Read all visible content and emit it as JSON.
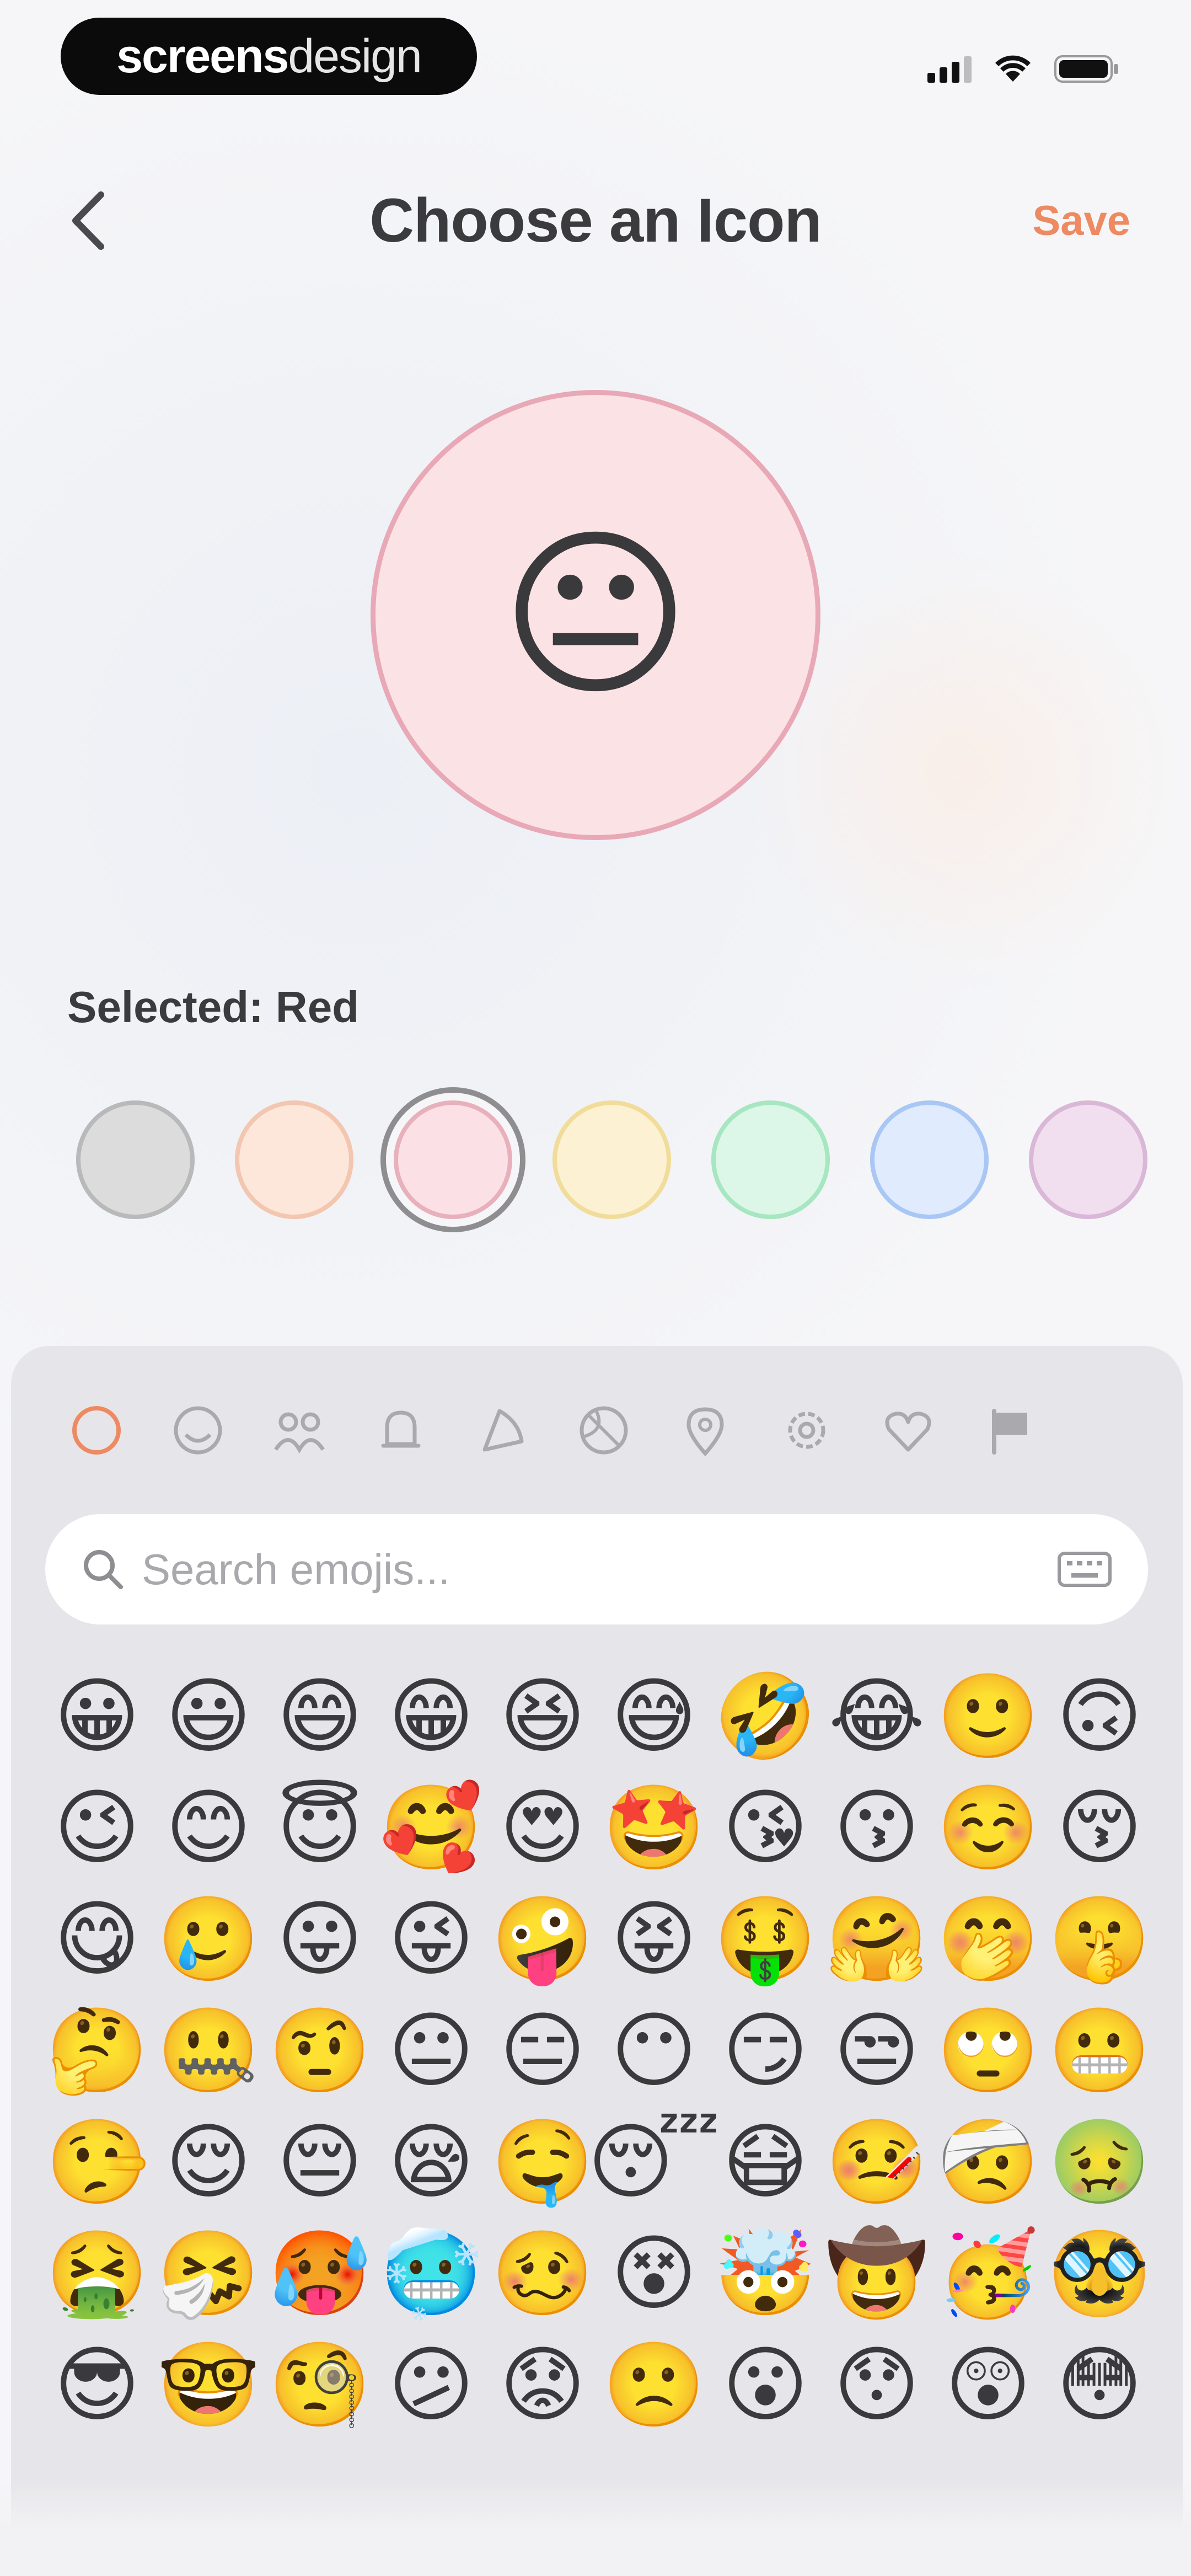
{
  "watermark": {
    "bold": "screens",
    "light": "design"
  },
  "nav": {
    "title": "Choose an Icon",
    "save_label": "Save"
  },
  "preview": {
    "emoji": "😐",
    "icon": "neutral-face"
  },
  "selected": {
    "label": "Selected: Red"
  },
  "swatches": [
    {
      "name": "Gray",
      "fill": "#dcdcdc",
      "border": "#b9b9bb",
      "selected": false
    },
    {
      "name": "Orange",
      "fill": "#fde6da",
      "border": "#f3c6b0",
      "selected": false
    },
    {
      "name": "Red",
      "fill": "#fbe1e5",
      "border": "#e8b0bb",
      "selected": true
    },
    {
      "name": "Yellow",
      "fill": "#fcf2d3",
      "border": "#f1dc9a",
      "selected": false
    },
    {
      "name": "Green",
      "fill": "#dcf6e7",
      "border": "#a6e6c1",
      "selected": false
    },
    {
      "name": "Blue",
      "fill": "#e0ebfd",
      "border": "#a9c7f5",
      "selected": false
    },
    {
      "name": "Purple",
      "fill": "#f1dff0",
      "border": "#d9b7d7",
      "selected": false
    }
  ],
  "categories": [
    {
      "icon": "clock-icon",
      "active": true
    },
    {
      "icon": "smiley-icon",
      "active": false
    },
    {
      "icon": "people-icon",
      "active": false
    },
    {
      "icon": "bell-icon",
      "active": false
    },
    {
      "icon": "food-icon",
      "active": false
    },
    {
      "icon": "ball-icon",
      "active": false
    },
    {
      "icon": "location-pin-icon",
      "active": false
    },
    {
      "icon": "gear-icon",
      "active": false
    },
    {
      "icon": "heart-icon",
      "active": false
    },
    {
      "icon": "flag-icon",
      "active": false
    }
  ],
  "search": {
    "placeholder": "Search emojis..."
  },
  "emojis": [
    "😀",
    "😃",
    "😄",
    "😁",
    "😆",
    "😅",
    "🤣",
    "😂",
    "🙂",
    "🙃",
    "😉",
    "😊",
    "😇",
    "🥰",
    "😍",
    "🤩",
    "😘",
    "😗",
    "☺️",
    "😚",
    "😋",
    "🥲",
    "😛",
    "😜",
    "🤪",
    "😝",
    "🤑",
    "🤗",
    "🤭",
    "🤫",
    "🤔",
    "🤐",
    "🤨",
    "😐",
    "😑",
    "😶",
    "😏",
    "😒",
    "🙄",
    "😬",
    "🤥",
    "😌",
    "😔",
    "😪",
    "🤤",
    "😴",
    "😷",
    "🤒",
    "🤕",
    "🤢",
    "🤮",
    "🤧",
    "🥵",
    "🥶",
    "🥴",
    "😵",
    "🤯",
    "🤠",
    "🥳",
    "🥸",
    "😎",
    "🤓",
    "🧐",
    "😕",
    "😟",
    "🙁",
    "😮",
    "😯",
    "😲",
    "😳"
  ],
  "colors": {
    "accent": "#ed8a62",
    "selected_ring": "#8e8e90"
  }
}
